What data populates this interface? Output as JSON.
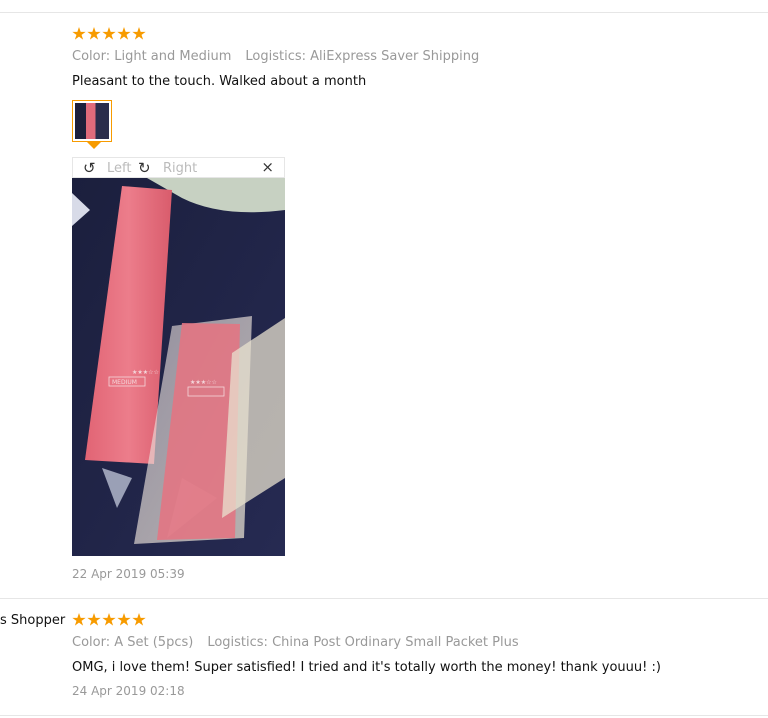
{
  "review1": {
    "rating": 5,
    "color_label": "Color: Light and Medium",
    "logistics_label": "Logistics: AliExpress Saver Shipping",
    "text": "Pleasant to the touch. Walked about a month",
    "date": "22 Apr 2019 05:39",
    "viewer": {
      "rotate_left": "Left",
      "rotate_right": "Right",
      "close": "×",
      "rotate_left_icon": "↺",
      "rotate_right_icon": "↻"
    }
  },
  "review2": {
    "user": "s Shopper",
    "rating": 5,
    "color_label": "Color: A Set (5pcs)",
    "logistics_label": "Logistics: China Post Ordinary Small Packet Plus",
    "text": "OMG, i love them! Super satisfied! I tried and it's totally worth the money! thank youuu! :)",
    "date": "24 Apr 2019 02:18"
  },
  "colors": {
    "star": "#f79b00",
    "meta_text": "#999999",
    "divider": "#e6e6e6"
  }
}
